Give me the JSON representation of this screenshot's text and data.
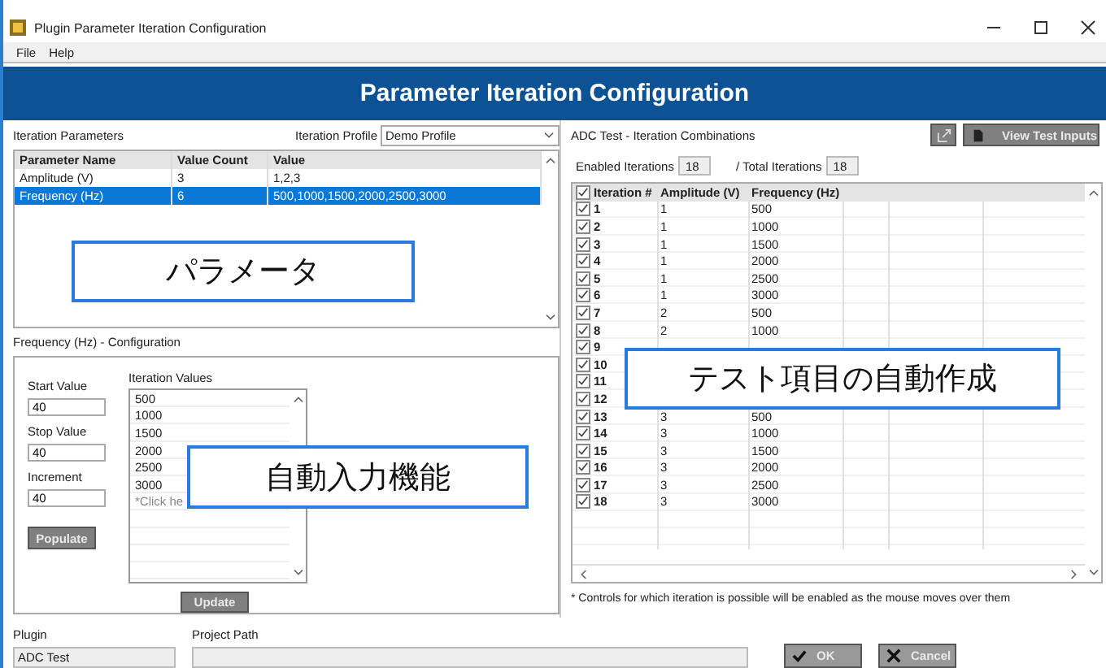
{
  "window": {
    "title": "Plugin Parameter Iteration Configuration"
  },
  "menu": [
    "File",
    "Help"
  ],
  "banner": "Parameter Iteration Configuration",
  "parameters": {
    "label": "Iteration Parameters",
    "profile_label": "Iteration Profile",
    "profile": "Demo Profile",
    "columns": [
      "Parameter Name",
      "Value Count",
      "Value"
    ],
    "rows": [
      {
        "cells": [
          "Amplitude (V)",
          "3",
          "1,2,3"
        ],
        "selected": false
      },
      {
        "cells": [
          "Frequency (Hz)",
          "6",
          "500,1000,1500,2000,2500,3000"
        ],
        "selected": true
      }
    ]
  },
  "configuration": {
    "title": "Frequency (Hz) - Configuration",
    "fields": [
      {
        "label": "Start Value",
        "value": "40"
      },
      {
        "label": "Stop Value",
        "value": "40"
      },
      {
        "label": "Increment",
        "value": "40"
      }
    ],
    "populate": "Populate",
    "values_label": "Iteration Values",
    "values": [
      "500",
      "1000",
      "1500",
      "2000",
      "2500",
      "3000"
    ],
    "hint": "*Click he",
    "update": "Update"
  },
  "combinations": {
    "title": "ADC Test - Iteration Combinations",
    "view_button": "View Test Inputs",
    "enabled_label": "Enabled Iterations",
    "enabled": "18",
    "total_label": "/  Total Iterations",
    "total": "18",
    "header_checked": true,
    "columns": [
      "Iteration #",
      "Amplitude (V)",
      "Frequency (Hz)"
    ],
    "rows": [
      {
        "checked": true,
        "cells": [
          "1",
          "1",
          "500"
        ]
      },
      {
        "checked": true,
        "cells": [
          "2",
          "1",
          "1000"
        ]
      },
      {
        "checked": true,
        "cells": [
          "3",
          "1",
          "1500"
        ]
      },
      {
        "checked": true,
        "cells": [
          "4",
          "1",
          "2000"
        ]
      },
      {
        "checked": true,
        "cells": [
          "5",
          "1",
          "2500"
        ]
      },
      {
        "checked": true,
        "cells": [
          "6",
          "1",
          "3000"
        ]
      },
      {
        "checked": true,
        "cells": [
          "7",
          "2",
          "500"
        ]
      },
      {
        "checked": true,
        "cells": [
          "8",
          "2",
          "1000"
        ]
      },
      {
        "checked": true,
        "cells": [
          "9"
        ]
      },
      {
        "checked": true,
        "cells": [
          "10"
        ]
      },
      {
        "checked": true,
        "cells": [
          "11"
        ]
      },
      {
        "checked": true,
        "cells": [
          "12"
        ]
      },
      {
        "checked": true,
        "cells": [
          "13",
          "3",
          "500"
        ]
      },
      {
        "checked": true,
        "cells": [
          "14",
          "3",
          "1000"
        ]
      },
      {
        "checked": true,
        "cells": [
          "15",
          "3",
          "1500"
        ]
      },
      {
        "checked": true,
        "cells": [
          "16",
          "3",
          "2000"
        ]
      },
      {
        "checked": true,
        "cells": [
          "17",
          "3",
          "2500"
        ]
      },
      {
        "checked": true,
        "cells": [
          "18",
          "3",
          "3000"
        ]
      }
    ]
  },
  "footnote": "* Controls for which iteration is possible will be enabled as the mouse moves over them",
  "plugin": {
    "label": "Plugin",
    "value": "ADC Test"
  },
  "project_path": {
    "label": "Project Path"
  },
  "buttons": [
    {
      "kind": "ok",
      "label": "OK"
    },
    {
      "kind": "cancel",
      "label": "Cancel"
    }
  ],
  "annotations": [
    "パラメータ",
    "自動入力機能",
    "テスト項目の自動作成"
  ]
}
